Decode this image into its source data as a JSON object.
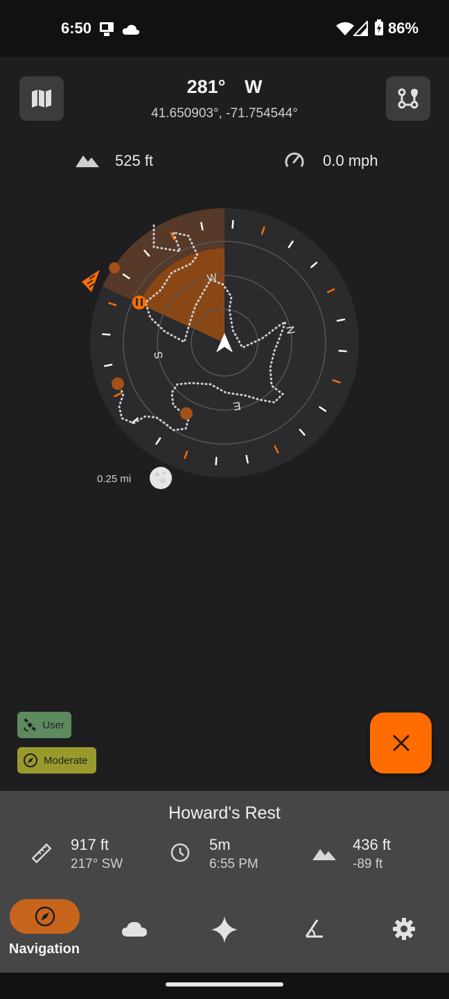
{
  "status_bar": {
    "time": "6:50",
    "battery_percent": "86%"
  },
  "header": {
    "heading_degrees": "281°",
    "heading_direction": "W",
    "coordinates": "41.650903°,  -71.754544°",
    "altitude": "525 ft",
    "speed": "0.0 mph"
  },
  "compass": {
    "cardinals": {
      "north": "N",
      "east": "E",
      "south": "S",
      "west": "W"
    },
    "scale_label": "0.25 mi",
    "accent_color": "#ff6d00"
  },
  "badges": {
    "location_source": "User",
    "compass_accuracy": "Moderate"
  },
  "destination": {
    "name": "Howard's Rest",
    "distance": "917 ft",
    "bearing": "217° SW",
    "eta_duration": "5m",
    "eta_time": "6:55 PM",
    "elevation": "436 ft",
    "elevation_change": "-89 ft"
  },
  "bottom_nav": {
    "active_label": "Navigation",
    "items": [
      "navigation-icon",
      "weather-icon",
      "astronomy-icon",
      "tools-icon",
      "settings-icon"
    ]
  }
}
